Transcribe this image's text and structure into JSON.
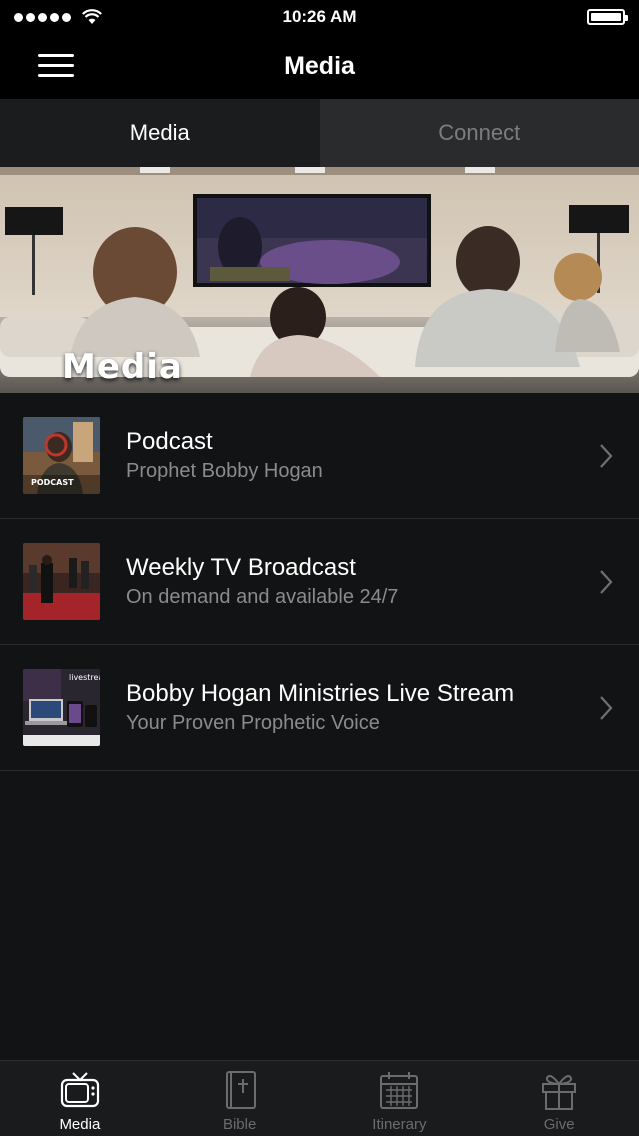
{
  "status_bar": {
    "time": "10:26 AM"
  },
  "nav": {
    "title": "Media"
  },
  "tabs": [
    {
      "label": "Media",
      "active": true
    },
    {
      "label": "Connect",
      "active": false
    }
  ],
  "banner": {
    "overlay_text": "Media"
  },
  "list": [
    {
      "title": "Podcast",
      "subtitle": "Prophet Bobby Hogan",
      "thumb_text": "PODCAST"
    },
    {
      "title": "Weekly TV Broadcast",
      "subtitle": "On demand and available 24/7"
    },
    {
      "title": "Bobby Hogan Ministries Live Stream",
      "subtitle": "Your Proven Prophetic Voice",
      "thumb_text": "livestream"
    }
  ],
  "tab_bar": [
    {
      "label": "Media",
      "icon": "tv-icon",
      "active": true
    },
    {
      "label": "Bible",
      "icon": "bible-icon",
      "active": false
    },
    {
      "label": "Itinerary",
      "icon": "calendar-icon",
      "active": false
    },
    {
      "label": "Give",
      "icon": "gift-icon",
      "active": false
    }
  ],
  "colors": {
    "background": "#121314",
    "bar": "#000000",
    "inactive_text": "#7c7d80"
  }
}
